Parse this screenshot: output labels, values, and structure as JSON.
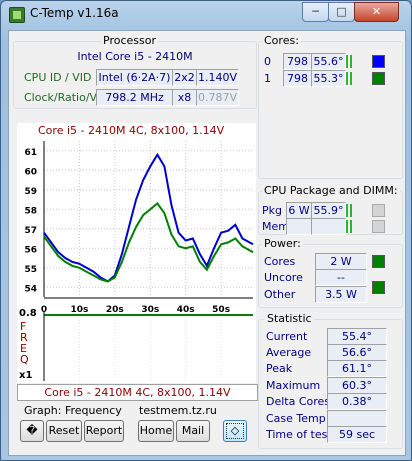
{
  "window": {
    "title": "C-Temp v1.16a",
    "minimize": "─",
    "maximize": "□",
    "close": "✕"
  },
  "processor": {
    "group_title": "Processor",
    "name": "Intel Core i5 - 2410M",
    "cpu_id_label": "CPU ID",
    "vid_label": "/ VID",
    "cpu_id": "Intel (6·2A·7)",
    "cores_threads": "2x2",
    "vid": "1.140V",
    "clock_label": "Clock/Ratio/V",
    "clock": "798.2 MHz",
    "ratio": "x8",
    "voltage": "0.787V"
  },
  "cores": {
    "group_title": "Cores:",
    "items": [
      {
        "index": "0",
        "freq": "798",
        "temp": "55.6°",
        "color": "#0000ff"
      },
      {
        "index": "1",
        "freq": "798",
        "temp": "55.3°",
        "color": "#008000"
      }
    ]
  },
  "package": {
    "group_title": "CPU Package and DIMM:",
    "pkg_label": "Pkg",
    "pkg_power": "6 W",
    "pkg_temp": "55.9°",
    "mem_label": "Mem"
  },
  "power": {
    "group_title": "Power:",
    "cores_label": "Cores",
    "cores_value": "2 W",
    "uncore_label": "Uncore",
    "uncore_value": "--",
    "other_label": "Other",
    "other_value": "3.5 W"
  },
  "statistic": {
    "group_title": "Statistic",
    "rows": [
      {
        "label": "Current",
        "value": "55.4°"
      },
      {
        "label": "Average",
        "value": "56.6°"
      },
      {
        "label": "Peak",
        "value": "61.1°"
      },
      {
        "label": "Maximum",
        "value": "60.3°"
      },
      {
        "label": "Delta Cores",
        "value": "0.38°"
      },
      {
        "label": "Case Temp",
        "value": ""
      },
      {
        "label": "Time of test",
        "value": "59 sec"
      }
    ]
  },
  "graph": {
    "header": "Core i5 - 2410M 4C, 8x100, 1.14V",
    "footer": "Core i5 - 2410M 4C, 8x100, 1.14V",
    "freq_label": "FREQ",
    "freq_top": "0.8",
    "freq_bottom": "x1",
    "mode_label": "Graph: Frequency",
    "site": "testmem.tz.ru"
  },
  "buttons": {
    "icon": "�",
    "reset": "Reset",
    "report": "Report",
    "home": "Home",
    "mail": "Mail",
    "settings": "◇"
  },
  "chart_data": {
    "type": "line",
    "title": "Core i5 - 2410M 4C, 8x100, 1.14V",
    "xlabel": "",
    "ylabel": "",
    "ylim": [
      53.5,
      61.5
    ],
    "xlim": [
      0,
      59
    ],
    "x_ticks": [
      "0",
      "10s",
      "20s",
      "30s",
      "40s",
      "50s"
    ],
    "y_ticks": [
      54,
      55,
      56,
      57,
      58,
      59,
      60,
      61
    ],
    "grid": true,
    "series": [
      {
        "color": "#0000cc",
        "x": [
          0,
          2,
          4,
          6,
          8,
          10,
          12,
          14,
          16,
          18,
          20,
          22,
          24,
          26,
          28,
          30,
          32,
          34,
          36,
          38,
          40,
          42,
          44,
          46,
          48,
          50,
          52,
          54,
          56,
          58,
          59
        ],
        "y": [
          56.8,
          56.3,
          55.8,
          55.5,
          55.3,
          55.2,
          55.0,
          54.8,
          54.5,
          54.3,
          54.6,
          55.7,
          57.1,
          58.5,
          59.5,
          60.2,
          60.8,
          60.2,
          58.2,
          56.8,
          56.4,
          56.5,
          55.7,
          55.1,
          56.0,
          56.8,
          56.9,
          57.2,
          56.5,
          56.3,
          56.2
        ]
      },
      {
        "color": "#008000",
        "x": [
          0,
          2,
          4,
          6,
          8,
          10,
          12,
          14,
          16,
          18,
          20,
          22,
          24,
          26,
          28,
          30,
          32,
          34,
          36,
          38,
          40,
          42,
          44,
          46,
          48,
          50,
          52,
          54,
          56,
          58,
          59
        ],
        "y": [
          56.6,
          56.1,
          55.6,
          55.3,
          55.1,
          55.0,
          54.8,
          54.6,
          54.4,
          54.3,
          54.5,
          55.3,
          56.3,
          57.1,
          57.7,
          58.0,
          58.3,
          57.8,
          56.7,
          56.1,
          56.0,
          56.1,
          55.3,
          54.9,
          55.6,
          56.2,
          56.3,
          56.5,
          56.1,
          55.9,
          55.8
        ]
      }
    ]
  }
}
